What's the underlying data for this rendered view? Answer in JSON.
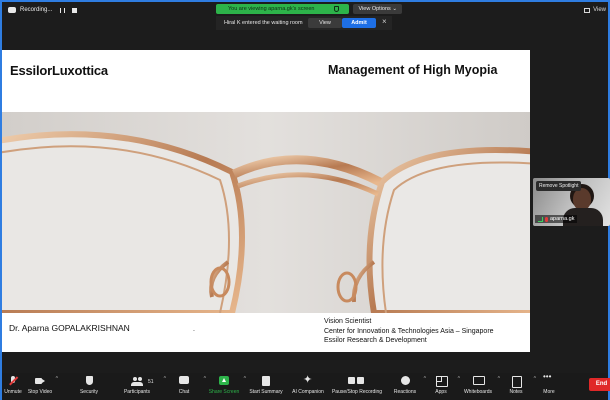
{
  "recording": {
    "label": "Recording..."
  },
  "top_right": {
    "label": "View"
  },
  "banner": {
    "text": "You are viewing aparna.gk's screen",
    "view_options": "View Options"
  },
  "waiting_room": {
    "message": "Hiral K entered the waiting room",
    "view_label": "View",
    "admit_label": "Admit"
  },
  "slide": {
    "logo": "EssilorLuxottica",
    "title": "Management of High Myopia",
    "presenter": "Dr. Aparna GOPALAKRISHNAN",
    "dot": ".",
    "affiliation": [
      "Vision Scientist",
      "Center for Innovation & Technologies Asia – Singapore",
      "Essilor Research & Development"
    ]
  },
  "self_video": {
    "remove_spotlight": "Remove Spotlight",
    "name": "aparna.gk"
  },
  "toolbar": {
    "items": [
      {
        "label": "Unmute",
        "icon": "mic-muted-icon"
      },
      {
        "label": "Stop Video",
        "icon": "camera-icon"
      },
      {
        "label": "Security",
        "icon": "shield-icon"
      },
      {
        "label": "Participants",
        "icon": "participants-icon",
        "count": "51"
      },
      {
        "label": "Chat",
        "icon": "chat-icon"
      },
      {
        "label": "Share Screen",
        "icon": "share-screen-icon"
      },
      {
        "label": "Start Summary",
        "icon": "summary-icon"
      },
      {
        "label": "AI Companion",
        "icon": "ai-companion-icon"
      },
      {
        "label": "Pause/Stop Recording",
        "icon": "recording-icon"
      },
      {
        "label": "Reactions",
        "icon": "reactions-icon"
      },
      {
        "label": "Apps",
        "icon": "apps-icon"
      },
      {
        "label": "Whiteboards",
        "icon": "whiteboards-icon"
      },
      {
        "label": "Notes",
        "icon": "notes-icon"
      },
      {
        "label": "More",
        "icon": "more-icon"
      }
    ],
    "end_label": "End"
  },
  "colors": {
    "accent_green": "#2db34a",
    "admit_blue": "#1e6fe5",
    "end_red": "#e02828",
    "window_border": "#2f7de1"
  }
}
